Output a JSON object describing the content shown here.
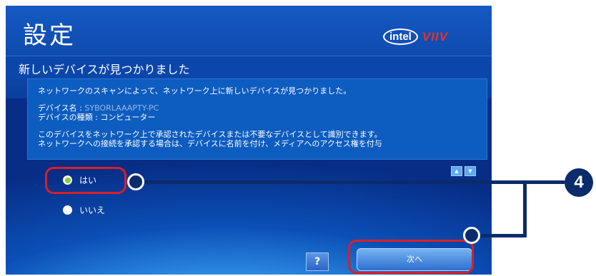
{
  "header": {
    "title": "設定",
    "subtitle": "新しいデバイスが見つかりました",
    "logo": {
      "intel": "intel",
      "viiv": "VIIV"
    }
  },
  "content": {
    "line1": "ネットワークのスキャンによって、ネットワーク上に新しいデバイスが見つかりました。",
    "device_name_label": "デバイス名 :",
    "device_name_value": "SYBORLAAAPTY-PC",
    "device_type_label": "デバイスの種類 :",
    "device_type_value": "コンピューター",
    "line4": "このデバイスをネットワーク上で承認されたデバイスまたは不要なデバイスとして識別できます。",
    "line5": "ネットワークへの接続を承認する場合は、デバイスに名前を付け、メディアへのアクセス権を付与"
  },
  "options": [
    {
      "label": "はい",
      "selected": true
    },
    {
      "label": "いいえ",
      "selected": false
    }
  ],
  "buttons": {
    "help": "?",
    "next": "次へ",
    "scroll_up": "▲",
    "scroll_down": "▼"
  },
  "callout": {
    "step": "4"
  },
  "colors": {
    "highlight": "#d81f2a",
    "callout": "#0b2b6b",
    "radio_selected": "#7fcf3a"
  }
}
